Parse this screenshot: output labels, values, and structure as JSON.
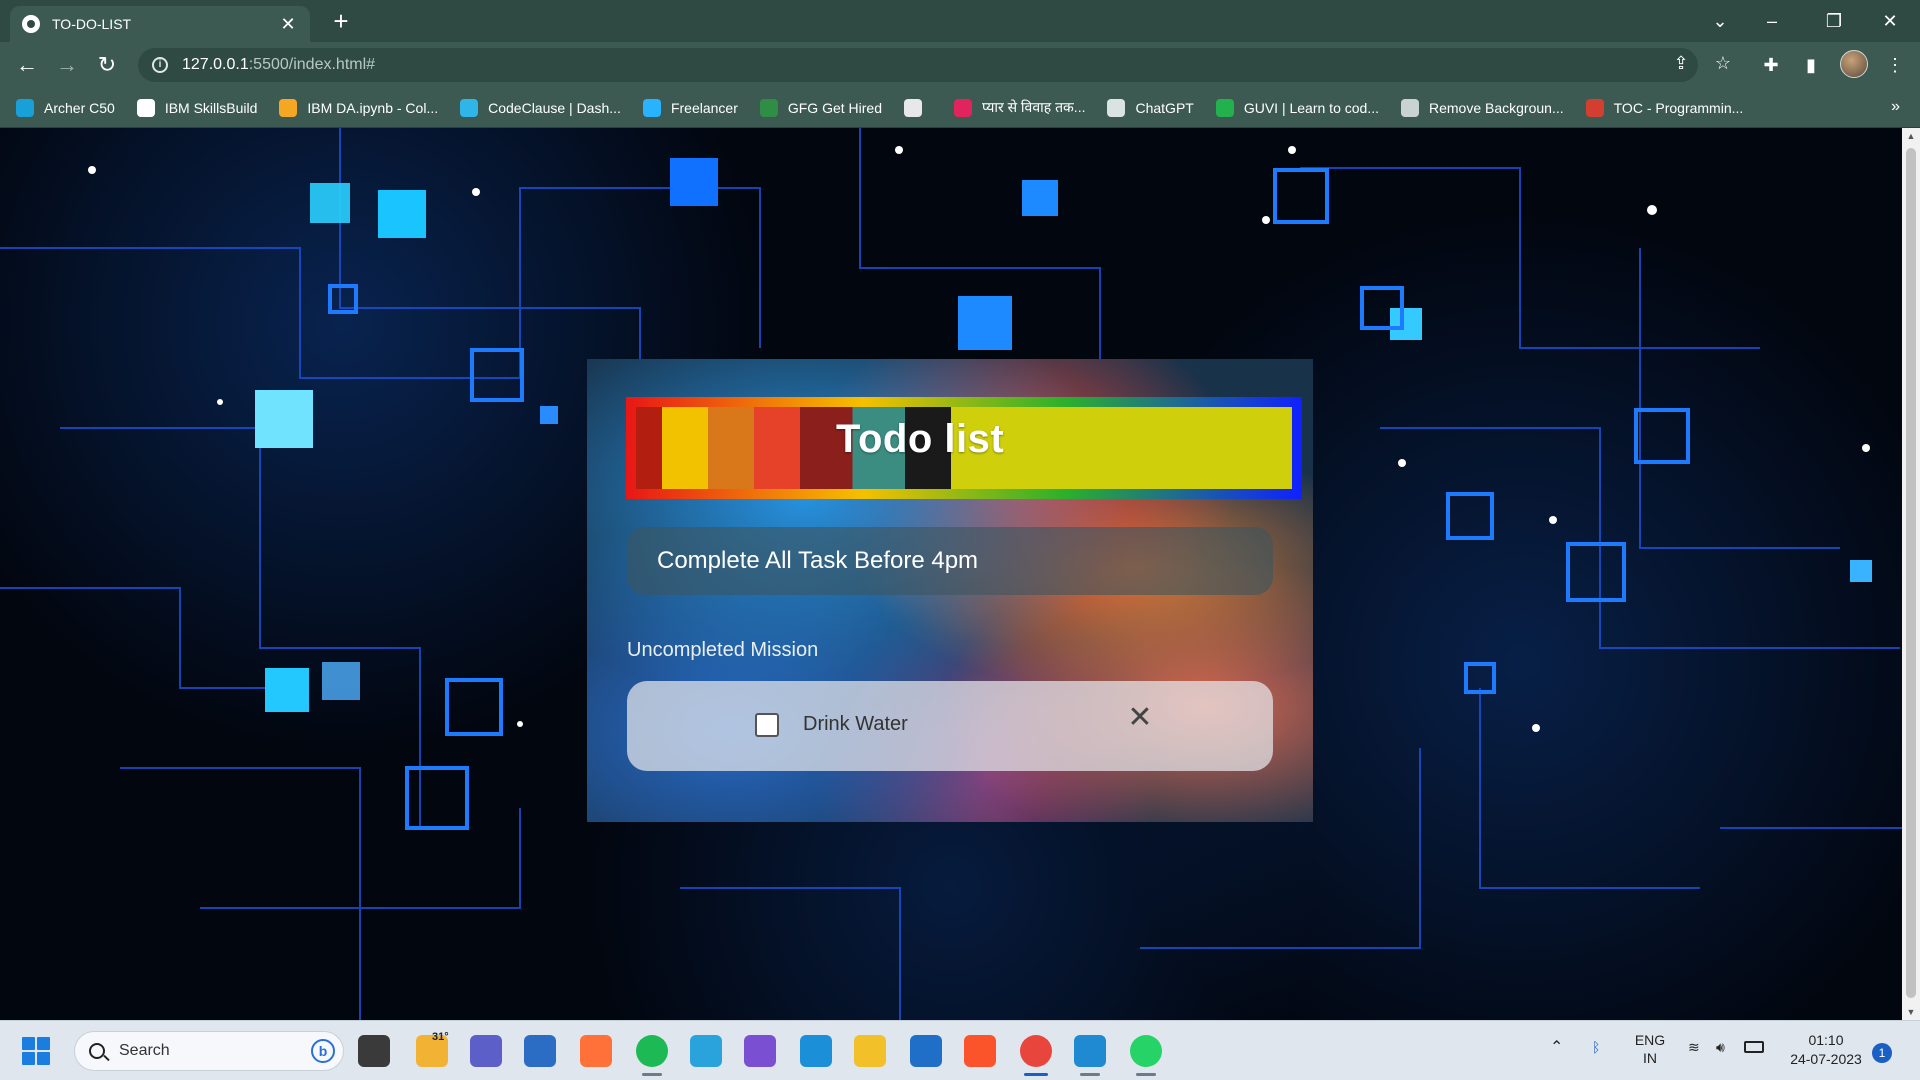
{
  "browser": {
    "tab_title": "TO-DO-LIST",
    "url_host": "127.0.0.1",
    "url_path": ":5500/index.html#",
    "bookmarks": [
      {
        "label": "Archer C50",
        "color": "#1aa0d8"
      },
      {
        "label": "IBM SkillsBuild",
        "color": "#ffffff"
      },
      {
        "label": "IBM DA.ipynb - Col...",
        "color": "#f5a623"
      },
      {
        "label": "CodeClause | Dash...",
        "color": "#2fb5e8"
      },
      {
        "label": "Freelancer",
        "color": "#29b2fe"
      },
      {
        "label": "GFG Get Hired",
        "color": "#2f8d46"
      },
      {
        "label": "",
        "color": "#e8e8e8"
      },
      {
        "label": "प्यार से विवाह तक...",
        "color": "#e0245e"
      },
      {
        "label": "ChatGPT",
        "color": "#d9e4e0"
      },
      {
        "label": "GUVI | Learn to cod...",
        "color": "#22b14c"
      },
      {
        "label": "Remove Backgroun...",
        "color": "#c9d3d0"
      },
      {
        "label": "TOC - Programmin...",
        "color": "#d23f31"
      }
    ],
    "bookmarks_overflow": "»"
  },
  "todo": {
    "title": "Todo list",
    "input_value": "Complete All Task Before 4pm",
    "section_label": "Uncompleted Mission",
    "tasks": [
      {
        "text": "Drink Water",
        "done": false
      }
    ],
    "delete_glyph": "✕"
  },
  "taskbar": {
    "search_placeholder": "Search",
    "weather_temp": "31°",
    "language_line1": "ENG",
    "language_line2": "IN",
    "time": "01:10",
    "date": "24-07-2023",
    "notification_count": "1",
    "apps": [
      {
        "name": "task-view",
        "color": "#3a3a3a"
      },
      {
        "name": "weather",
        "color": "#f2b233"
      },
      {
        "name": "meet",
        "color": "#5b5fc7"
      },
      {
        "name": "store",
        "color": "#2b6cc4"
      },
      {
        "name": "firefox",
        "color": "#ff7139"
      },
      {
        "name": "spotify",
        "color": "#1db954"
      },
      {
        "name": "telegram",
        "color": "#2aa3dd"
      },
      {
        "name": "clipchamp",
        "color": "#7b4fd1"
      },
      {
        "name": "edge",
        "color": "#1b8fd8"
      },
      {
        "name": "file-explorer",
        "color": "#f2c029"
      },
      {
        "name": "mail",
        "color": "#1f6fc8"
      },
      {
        "name": "brave",
        "color": "#fb542b"
      },
      {
        "name": "chrome",
        "color": "#e8453c"
      },
      {
        "name": "vscode",
        "color": "#1f8ad2"
      },
      {
        "name": "whatsapp",
        "color": "#25d366"
      }
    ]
  }
}
